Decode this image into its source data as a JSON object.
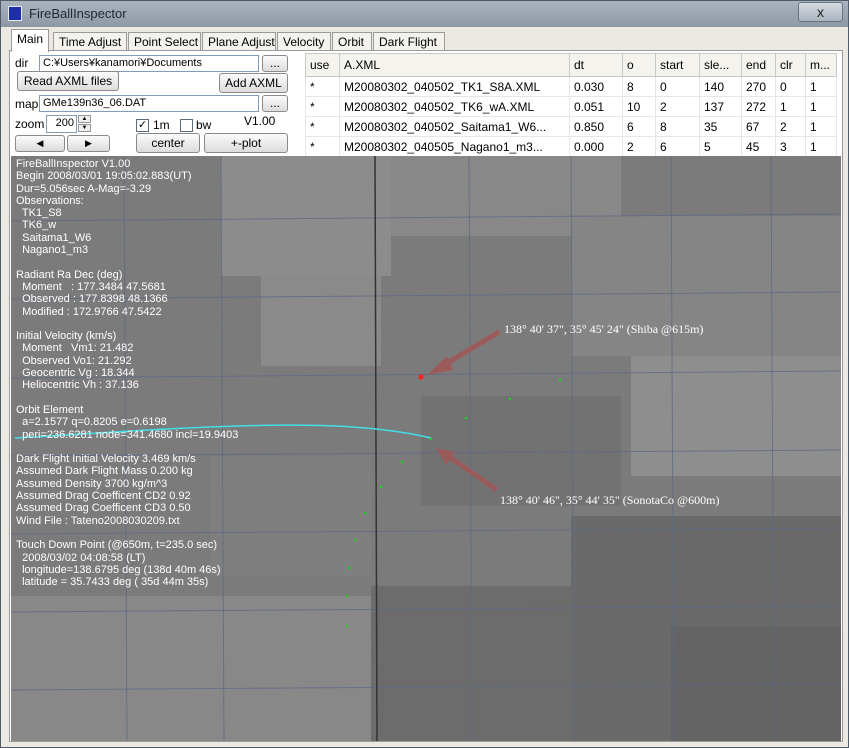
{
  "window": {
    "title": "FireBallInspector",
    "close": "x"
  },
  "tabs": [
    "Main",
    "Time Adjust",
    "Point Select",
    "Plane Adjust",
    "Velocity",
    "Orbit",
    "Dark Flight"
  ],
  "controls": {
    "dir_label": "dir",
    "dir_value": "C:¥Users¥kanamori¥Documents",
    "browse_label": "...",
    "read_button": "Read AXML files",
    "add_button": "Add AXML",
    "map_label": "map",
    "map_value": "GMe139n36_06.DAT",
    "zoom_label": "zoom",
    "zoom_value": "200",
    "check_1m_label": "1m",
    "check_1m_checked": "✓",
    "check_bw_label": "bw",
    "version": "V1.00",
    "left_arrow": "◀",
    "right_arrow": "▶",
    "center_button": "center",
    "plot_button": "+-plot"
  },
  "table": {
    "headers": [
      "use",
      "A.XML",
      "dt",
      "o",
      "start",
      "sle...",
      "end",
      "clr",
      "m..."
    ],
    "rows": [
      [
        "*",
        "M20080302_040502_TK1_S8A.XML",
        "0.030",
        "8",
        "0",
        "140",
        "270",
        "0",
        "1"
      ],
      [
        "*",
        "M20080302_040502_TK6_wA.XML",
        "0.051",
        "10",
        "2",
        "137",
        "272",
        "1",
        "1"
      ],
      [
        "*",
        "M20080302_040502_Saitama1_W6...",
        "0.850",
        "6",
        "8",
        "35",
        "67",
        "2",
        "1"
      ],
      [
        "*",
        "M20080302_040505_Nagano1_m3...",
        "0.000",
        "2",
        "6",
        "5",
        "45",
        "3",
        "1"
      ]
    ]
  },
  "overlay_lines": [
    "FireBallInspector V1.00",
    "Begin 2008/03/01 19:05:02.883(UT)",
    "Dur=5.056sec A-Mag=-3.29",
    "Observations:",
    "  TK1_S8",
    "  TK6_w",
    "  Saitama1_W6",
    "  Nagano1_m3",
    "",
    "Radiant Ra Dec (deg)",
    "  Moment   : 177.3484 47.5681",
    "  Observed : 177.8398 48.1366",
    "  Modified : 172.9766 47.5422",
    "",
    "Initial Velocity (km/s)",
    "  Moment   Vm1: 21.482",
    "  Observed Vo1: 21.292",
    "  Geocentric Vg : 18.344",
    "  Heliocentric Vh : 37.136",
    "",
    "Orbit Element",
    "  a=2.1577 q=0.8205 e=0.6198",
    "  peri=236.6281 node=341.4680 incl=19.9403",
    "",
    "Dark Flight Initial Velocity 3.469 km/s",
    "Assumed Dark Flight Mass 0.200 kg",
    "Assumed Density 3700 kg/m^3",
    "Assumed Drag Coefficent CD2 0.92",
    "Assumed Drag Coefficent CD3 0.50",
    "Wind File : Tateno2008030209.txt",
    "",
    "Touch Down Point (@650m, t=235.0 sec)",
    "  2008/03/02 04:08:58 (LT)",
    "  longitude=138.6795 deg (138d 40m 46s)",
    "  latitude = 35.7433 deg ( 35d 44m 35s)"
  ],
  "annotations": {
    "shiba": "138°  40'  37\",  35°  45'  24\" (Shiba @615m)",
    "sonota": "138°  40'  46\",  35°  44'  35\" (SonotaCo @600m)"
  },
  "colors": {
    "trajectory": "#40e0e8",
    "point_red": "#ff2020",
    "points_green": "#20d020",
    "arrow": "#a05858"
  }
}
